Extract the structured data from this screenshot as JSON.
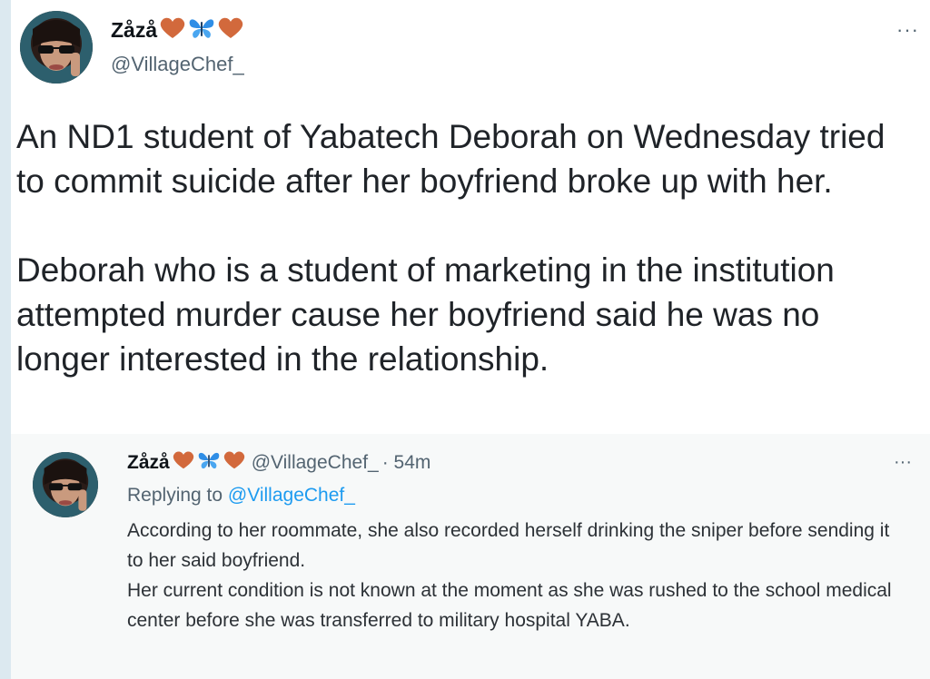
{
  "tweet": {
    "display_name": "Zåzå",
    "handle": "@VillageChef_",
    "more_label": "···",
    "text": "An ND1 student of Yabatech Deborah on Wednesday tried to commit suicide after her boyfriend broke up with her.\n\nDeborah who is a student of marketing in the institution attempted murder cause her boyfriend said he was no longer interested in the relationship.",
    "emojis": [
      "heart-orange-icon",
      "butterfly-blue-icon",
      "heart-orange-icon"
    ],
    "colors": {
      "heart": "#d2693c",
      "butterfly": "#2f8ee6",
      "link": "#1d9bf0",
      "muted": "#536471"
    }
  },
  "reply": {
    "display_name": "Zåzå",
    "handle": "@VillageChef_",
    "time": "· 54m",
    "replying_prefix": "Replying to",
    "replying_to": "@VillageChef_",
    "more_label": "···",
    "text": "According to her roommate, she also recorded herself drinking the sniper before sending it to her said boyfriend.\nHer current condition is not known at the moment as she was rushed to the school medical center before she was transferred to military hospital YABA."
  }
}
